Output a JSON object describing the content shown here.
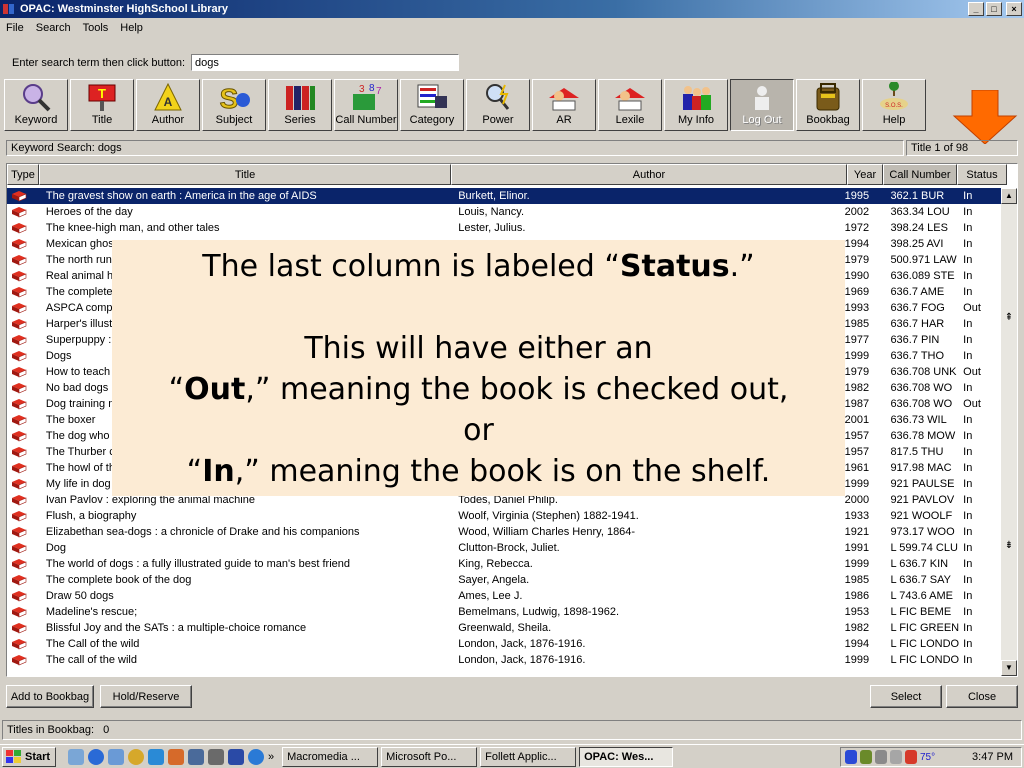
{
  "window": {
    "title": "OPAC: Westminster HighSchool Library"
  },
  "menu": [
    "File",
    "Search",
    "Tools",
    "Help"
  ],
  "search": {
    "label": "Enter search term then click button:",
    "value": "dogs"
  },
  "toolbar": [
    {
      "label": "Keyword",
      "icon": "magnifier-icon"
    },
    {
      "label": "Title",
      "icon": "title-sign-icon"
    },
    {
      "label": "Author",
      "icon": "author-icon"
    },
    {
      "label": "Subject",
      "icon": "subject-icon"
    },
    {
      "label": "Series",
      "icon": "books-series-icon"
    },
    {
      "label": "Call Number",
      "icon": "call-number-icon"
    },
    {
      "label": "Category",
      "icon": "category-icon"
    },
    {
      "label": "Power",
      "icon": "power-icon"
    },
    {
      "label": "AR",
      "icon": "ar-reader-icon"
    },
    {
      "label": "Lexile",
      "icon": "lexile-reader-icon"
    },
    {
      "label": "My Info",
      "icon": "people-icon"
    },
    {
      "label": "Log Out",
      "icon": "logout-icon"
    },
    {
      "label": "Bookbag",
      "icon": "bookbag-icon"
    },
    {
      "label": "Help",
      "icon": "sos-icon"
    }
  ],
  "status": {
    "search_text": "Keyword Search: dogs",
    "count": "Title 1 of 98"
  },
  "columns": {
    "type": "Type",
    "title": "Title",
    "author": "Author",
    "year": "Year",
    "call": "Call Number",
    "status": "Status"
  },
  "rows": [
    {
      "title": "The gravest show on earth : America in the age of AIDS",
      "author": "Burkett, Elinor.",
      "year": "1995",
      "call": "362.1 BUR",
      "status": "In"
    },
    {
      "title": "Heroes of the day",
      "author": "Louis, Nancy.",
      "year": "2002",
      "call": "363.34 LOU",
      "status": "In"
    },
    {
      "title": "The knee-high man, and other tales",
      "author": "Lester, Julius.",
      "year": "1972",
      "call": "398.24 LES",
      "status": "In"
    },
    {
      "title": "Mexican ghos",
      "author": "",
      "year": "1994",
      "call": "398.25 AVI",
      "status": "In"
    },
    {
      "title": "The north run",
      "author": "",
      "year": "1979",
      "call": "500.971 LAW",
      "status": "In"
    },
    {
      "title": "Real animal h",
      "author": "",
      "year": "1990",
      "call": "636.089 STE",
      "status": "In"
    },
    {
      "title": "The complete",
      "author": "",
      "year": "1969",
      "call": "636.7 AME",
      "status": "In"
    },
    {
      "title": "ASPCA compl",
      "author": "",
      "year": "1993",
      "call": "636.7 FOG",
      "status": "Out"
    },
    {
      "title": "Harper's illustr",
      "author": "",
      "year": "1985",
      "call": "636.7 HAR",
      "status": "In"
    },
    {
      "title": "Superpuppy :",
      "author": "",
      "year": "1977",
      "call": "636.7 PIN",
      "status": "In"
    },
    {
      "title": "Dogs",
      "author": "",
      "year": "1999",
      "call": "636.7 THO",
      "status": "In"
    },
    {
      "title": "How to teach",
      "author": "",
      "year": "1979",
      "call": "636.708 UNK",
      "status": "Out"
    },
    {
      "title": "No bad dogs",
      "author": "",
      "year": "1982",
      "call": "636.708 WO",
      "status": "In"
    },
    {
      "title": "Dog training m",
      "author": "",
      "year": "1987",
      "call": "636.708 WO",
      "status": "Out"
    },
    {
      "title": "The boxer",
      "author": "",
      "year": "2001",
      "call": "636.73 WIL",
      "status": "In"
    },
    {
      "title": "The dog who",
      "author": "",
      "year": "1957",
      "call": "636.78 MOW",
      "status": "In"
    },
    {
      "title": "The Thurber c",
      "author": "",
      "year": "1957",
      "call": "817.5 THU",
      "status": "In"
    },
    {
      "title": "The howl of th",
      "author": "",
      "year": "1961",
      "call": "917.98 MAC",
      "status": "In"
    },
    {
      "title": "My life in dog",
      "author": "",
      "year": "1999",
      "call": "921 PAULSE",
      "status": "In"
    },
    {
      "title": "Ivan Pavlov : exploring the animal machine",
      "author": "Todes, Daniel Philip.",
      "year": "2000",
      "call": "921 PAVLOV",
      "status": "In"
    },
    {
      "title": "Flush, a biography",
      "author": "Woolf, Virginia (Stephen) 1882-1941.",
      "year": "1933",
      "call": "921 WOOLF",
      "status": "In"
    },
    {
      "title": "Elizabethan sea-dogs : a chronicle of Drake and his companions",
      "author": "Wood, William Charles Henry, 1864-",
      "year": "1921",
      "call": "973.17 WOO",
      "status": "In"
    },
    {
      "title": "Dog",
      "author": "Clutton-Brock, Juliet.",
      "year": "1991",
      "call": "L 599.74 CLU",
      "status": "In"
    },
    {
      "title": "The world of dogs : a fully illustrated guide to man's best friend",
      "author": "King, Rebecca.",
      "year": "1999",
      "call": "L 636.7 KIN",
      "status": "In"
    },
    {
      "title": "The complete book of the dog",
      "author": "Sayer, Angela.",
      "year": "1985",
      "call": "L 636.7 SAY",
      "status": "In"
    },
    {
      "title": "Draw 50 dogs",
      "author": "Ames, Lee J.",
      "year": "1986",
      "call": "L 743.6 AME",
      "status": "In"
    },
    {
      "title": "Madeline's rescue;",
      "author": "Bemelmans, Ludwig, 1898-1962.",
      "year": "1953",
      "call": "L FIC  BEME",
      "status": "In"
    },
    {
      "title": "Blissful Joy and the SATs : a multiple-choice romance",
      "author": "Greenwald, Sheila.",
      "year": "1982",
      "call": "L FIC GREEN",
      "status": "In"
    },
    {
      "title": "The Call of the wild",
      "author": "London, Jack, 1876-1916.",
      "year": "1994",
      "call": "L FIC LONDO",
      "status": "In"
    },
    {
      "title": "The call of the wild",
      "author": "London, Jack, 1876-1916.",
      "year": "1999",
      "call": "L FIC LONDO",
      "status": "In"
    }
  ],
  "overlay": {
    "l1a": "The last column is labeled “",
    "l1b": "Status",
    "l1c": ".”",
    "l2": "This will have either an",
    "l3a": "“",
    "l3b": "Out",
    "l3c": ",” meaning the book is checked out,",
    "l4": "or",
    "l5a": "“",
    "l5b": "In",
    "l5c": ",” meaning the book is on the shelf."
  },
  "buttons": {
    "add_bookbag": "Add to Bookbag",
    "hold": "Hold/Reserve",
    "select": "Select",
    "close": "Close"
  },
  "bookbag": {
    "label": "Titles in Bookbag:",
    "count": "0"
  },
  "taskbar": {
    "start": "Start",
    "tasks": [
      "Macromedia ...",
      "Microsoft Po...",
      "Follett Applic...",
      "OPAC: Wes..."
    ],
    "clock": "3:47 PM",
    "tray_temp": "75°"
  },
  "colors": {
    "title_bar": "#0a246a",
    "selection": "#0a246a",
    "overlay_bg": "#fcebd4",
    "arrow": "#ff6a00"
  }
}
